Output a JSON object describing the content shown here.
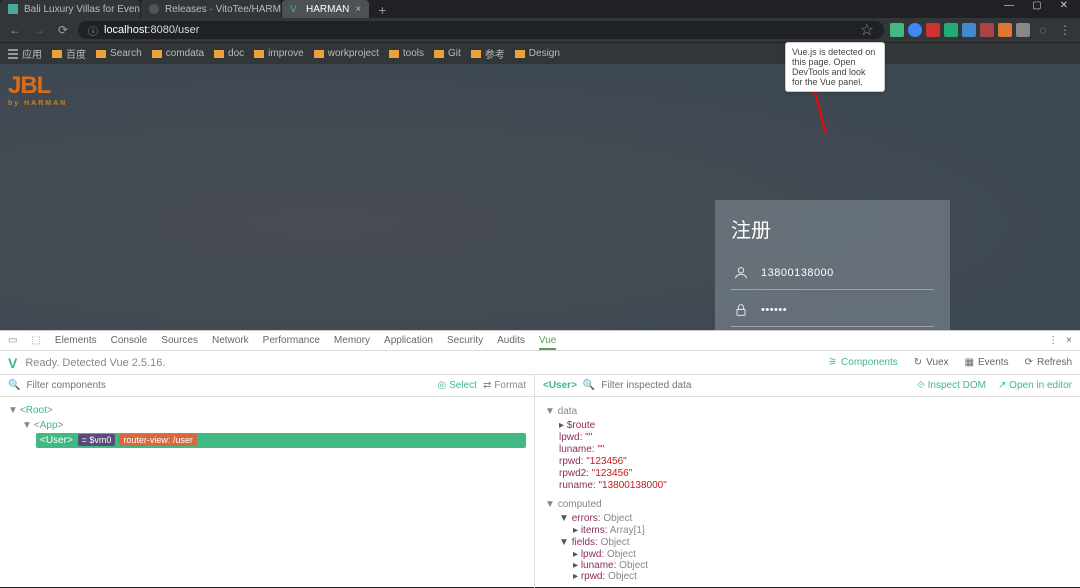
{
  "browser": {
    "tabs": [
      {
        "title": "Bali Luxury Villas for Events an",
        "active": false
      },
      {
        "title": "Releases · VitoTee/HARMAN",
        "active": false
      },
      {
        "title": "HARMAN",
        "active": true
      }
    ],
    "url_display": "localhost:8080/user",
    "url_host": "localhost",
    "url_port": ":8080",
    "url_path": "/user",
    "bookmarks": [
      {
        "label": "应用"
      },
      {
        "label": "百度"
      },
      {
        "label": "Search"
      },
      {
        "label": "comdata"
      },
      {
        "label": "doc"
      },
      {
        "label": "improve"
      },
      {
        "label": "workproject"
      },
      {
        "label": "tools"
      },
      {
        "label": "Git"
      },
      {
        "label": "参考"
      },
      {
        "label": "Design"
      }
    ],
    "tooltip": "Vue.js is detected on this page. Open DevTools and look for the Vue panel."
  },
  "hero": {
    "logo": "JBL",
    "logo_sub": "by HARMAN",
    "signup": {
      "title": "注册",
      "username": "13800138000",
      "password": "••••••"
    }
  },
  "devtools": {
    "tabs": [
      "Elements",
      "Console",
      "Sources",
      "Network",
      "Performance",
      "Memory",
      "Application",
      "Security",
      "Audits",
      "Vue"
    ],
    "active_tab": "Vue",
    "status": "Ready. Detected Vue 2.5.16.",
    "vue_tabs": [
      {
        "label": "Components",
        "active": true
      },
      {
        "label": "Vuex",
        "active": false
      },
      {
        "label": "Events",
        "active": false
      },
      {
        "label": "Refresh",
        "active": false
      }
    ],
    "filter_placeholder": "Filter components",
    "select_label": "Select",
    "format_label": "Format",
    "tree": {
      "root": "Root",
      "app": "App",
      "user": "User",
      "badge_vm": "= $vm0",
      "badge_route": "router-view: /user"
    },
    "inspect": {
      "current": "<User>",
      "filter_placeholder": "Filter inspected data",
      "inspect_dom": "Inspect DOM",
      "open_editor": "Open in editor",
      "data_label": "data",
      "computed_label": "computed",
      "fields": {
        "route": "$route",
        "lpwd_k": "lpwd:",
        "lpwd_v": "\"\"",
        "luname_k": "luname:",
        "luname_v": "\"\"",
        "rpwd_k": "rpwd:",
        "rpwd_v": "\"123456\"",
        "rpwd2_k": "rpwd2:",
        "rpwd2_v": "\"123456\"",
        "runame_k": "runame:",
        "runame_v": "\"13800138000\"",
        "errors_k": "errors:",
        "errors_v": "Object",
        "items_k": "items:",
        "items_v": "Array[1]",
        "fields_k": "fields:",
        "fields_v": "Object",
        "c_lpwd_k": "lpwd:",
        "c_lpwd_v": "Object",
        "c_luname_k": "luname:",
        "c_luname_v": "Object",
        "c_rpwd_k": "rpwd:",
        "c_rpwd_v": "Object"
      }
    }
  }
}
